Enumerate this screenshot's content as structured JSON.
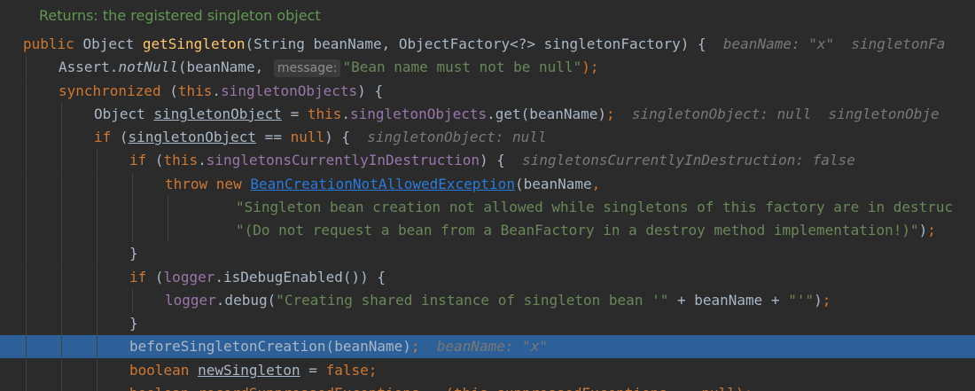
{
  "editor": {
    "doc_comment": "Returns: the registered singleton object",
    "lines": [
      [
        {
          "t": "public ",
          "c": "kw"
        },
        {
          "t": "Object ",
          "c": "plain"
        },
        {
          "t": "getSingleton",
          "c": "fn"
        },
        {
          "t": "(String beanName, ObjectFactory<?> singletonFactory) {",
          "c": "plain"
        },
        {
          "t": "  beanName: \"x\"  singletonFa",
          "c": "hint"
        }
      ],
      [
        {
          "t": "Assert.",
          "c": "plain"
        },
        {
          "t": "notNull",
          "c": "plain ital"
        },
        {
          "t": "(beanName, ",
          "c": "plain"
        },
        {
          "t": "message:",
          "c": "param-hint"
        },
        {
          "t": "\"Bean name must not be null\"",
          "c": "str"
        },
        {
          "t": ");",
          "c": "kw"
        }
      ],
      [
        {
          "t": "synchronized ",
          "c": "kw"
        },
        {
          "t": "(",
          "c": "plain"
        },
        {
          "t": "this",
          "c": "kw"
        },
        {
          "t": ".",
          "c": "plain"
        },
        {
          "t": "singletonObjects",
          "c": "fld"
        },
        {
          "t": ") {",
          "c": "plain"
        }
      ],
      [
        {
          "t": "Object ",
          "c": "plain"
        },
        {
          "t": "singletonObject",
          "c": "plain var"
        },
        {
          "t": " = ",
          "c": "plain"
        },
        {
          "t": "this",
          "c": "kw"
        },
        {
          "t": ".",
          "c": "plain"
        },
        {
          "t": "singletonObjects",
          "c": "fld"
        },
        {
          "t": ".get(beanName)",
          "c": "plain"
        },
        {
          "t": ";",
          "c": "kw"
        },
        {
          "t": "  singletonObject: null  singletonObje",
          "c": "hint"
        }
      ],
      [
        {
          "t": "if ",
          "c": "kw"
        },
        {
          "t": "(",
          "c": "plain"
        },
        {
          "t": "singletonObject",
          "c": "plain var"
        },
        {
          "t": " == ",
          "c": "plain"
        },
        {
          "t": "null",
          "c": "kw"
        },
        {
          "t": ") {",
          "c": "plain"
        },
        {
          "t": "  singletonObject: null",
          "c": "hint"
        }
      ],
      [
        {
          "t": "if ",
          "c": "kw"
        },
        {
          "t": "(",
          "c": "plain"
        },
        {
          "t": "this",
          "c": "kw"
        },
        {
          "t": ".",
          "c": "plain"
        },
        {
          "t": "singletonsCurrentlyInDestruction",
          "c": "fld"
        },
        {
          "t": ") {",
          "c": "plain"
        },
        {
          "t": "  singletonsCurrentlyInDestruction: false",
          "c": "hint"
        }
      ],
      [
        {
          "t": "throw new ",
          "c": "kw"
        },
        {
          "t": "BeanCreationNotAllowedException",
          "c": "link"
        },
        {
          "t": "(beanName",
          "c": "plain"
        },
        {
          "t": ",",
          "c": "kw"
        }
      ],
      [
        {
          "t": "\"Singleton bean creation not allowed while singletons of this factory are in destruc",
          "c": "str"
        }
      ],
      [
        {
          "t": "\"(Do not request a bean from a BeanFactory in a destroy method implementation!)\"",
          "c": "str"
        },
        {
          "t": ")",
          "c": "plain"
        },
        {
          "t": ";",
          "c": "kw"
        }
      ],
      [
        {
          "t": "}",
          "c": "plain"
        }
      ],
      [
        {
          "t": "if ",
          "c": "kw"
        },
        {
          "t": "(",
          "c": "plain"
        },
        {
          "t": "logger",
          "c": "fld"
        },
        {
          "t": ".isDebugEnabled()) {",
          "c": "plain"
        }
      ],
      [
        {
          "t": "logger",
          "c": "fld"
        },
        {
          "t": ".debug(",
          "c": "plain"
        },
        {
          "t": "\"Creating shared instance of singleton bean '\"",
          "c": "str"
        },
        {
          "t": " + beanName + ",
          "c": "plain"
        },
        {
          "t": "\"'\"",
          "c": "str"
        },
        {
          "t": ")",
          "c": "plain"
        },
        {
          "t": ";",
          "c": "kw"
        }
      ],
      [
        {
          "t": "}",
          "c": "plain"
        }
      ],
      [
        {
          "t": "beforeSingletonCreation(beanName)",
          "c": "plain"
        },
        {
          "t": ";",
          "c": "kw"
        },
        {
          "t": "  beanName: \"x\"",
          "c": "hint"
        }
      ],
      [
        {
          "t": "boolean ",
          "c": "kw"
        },
        {
          "t": "newSingleton",
          "c": "plain var"
        },
        {
          "t": " = ",
          "c": "plain"
        },
        {
          "t": "false",
          "c": "kw"
        },
        {
          "t": ";",
          "c": "kw"
        }
      ],
      [
        {
          "t": "boolean recordSuppressedExceptions = (this.suppressedExceptions == null);",
          "c": "kw"
        }
      ]
    ]
  }
}
